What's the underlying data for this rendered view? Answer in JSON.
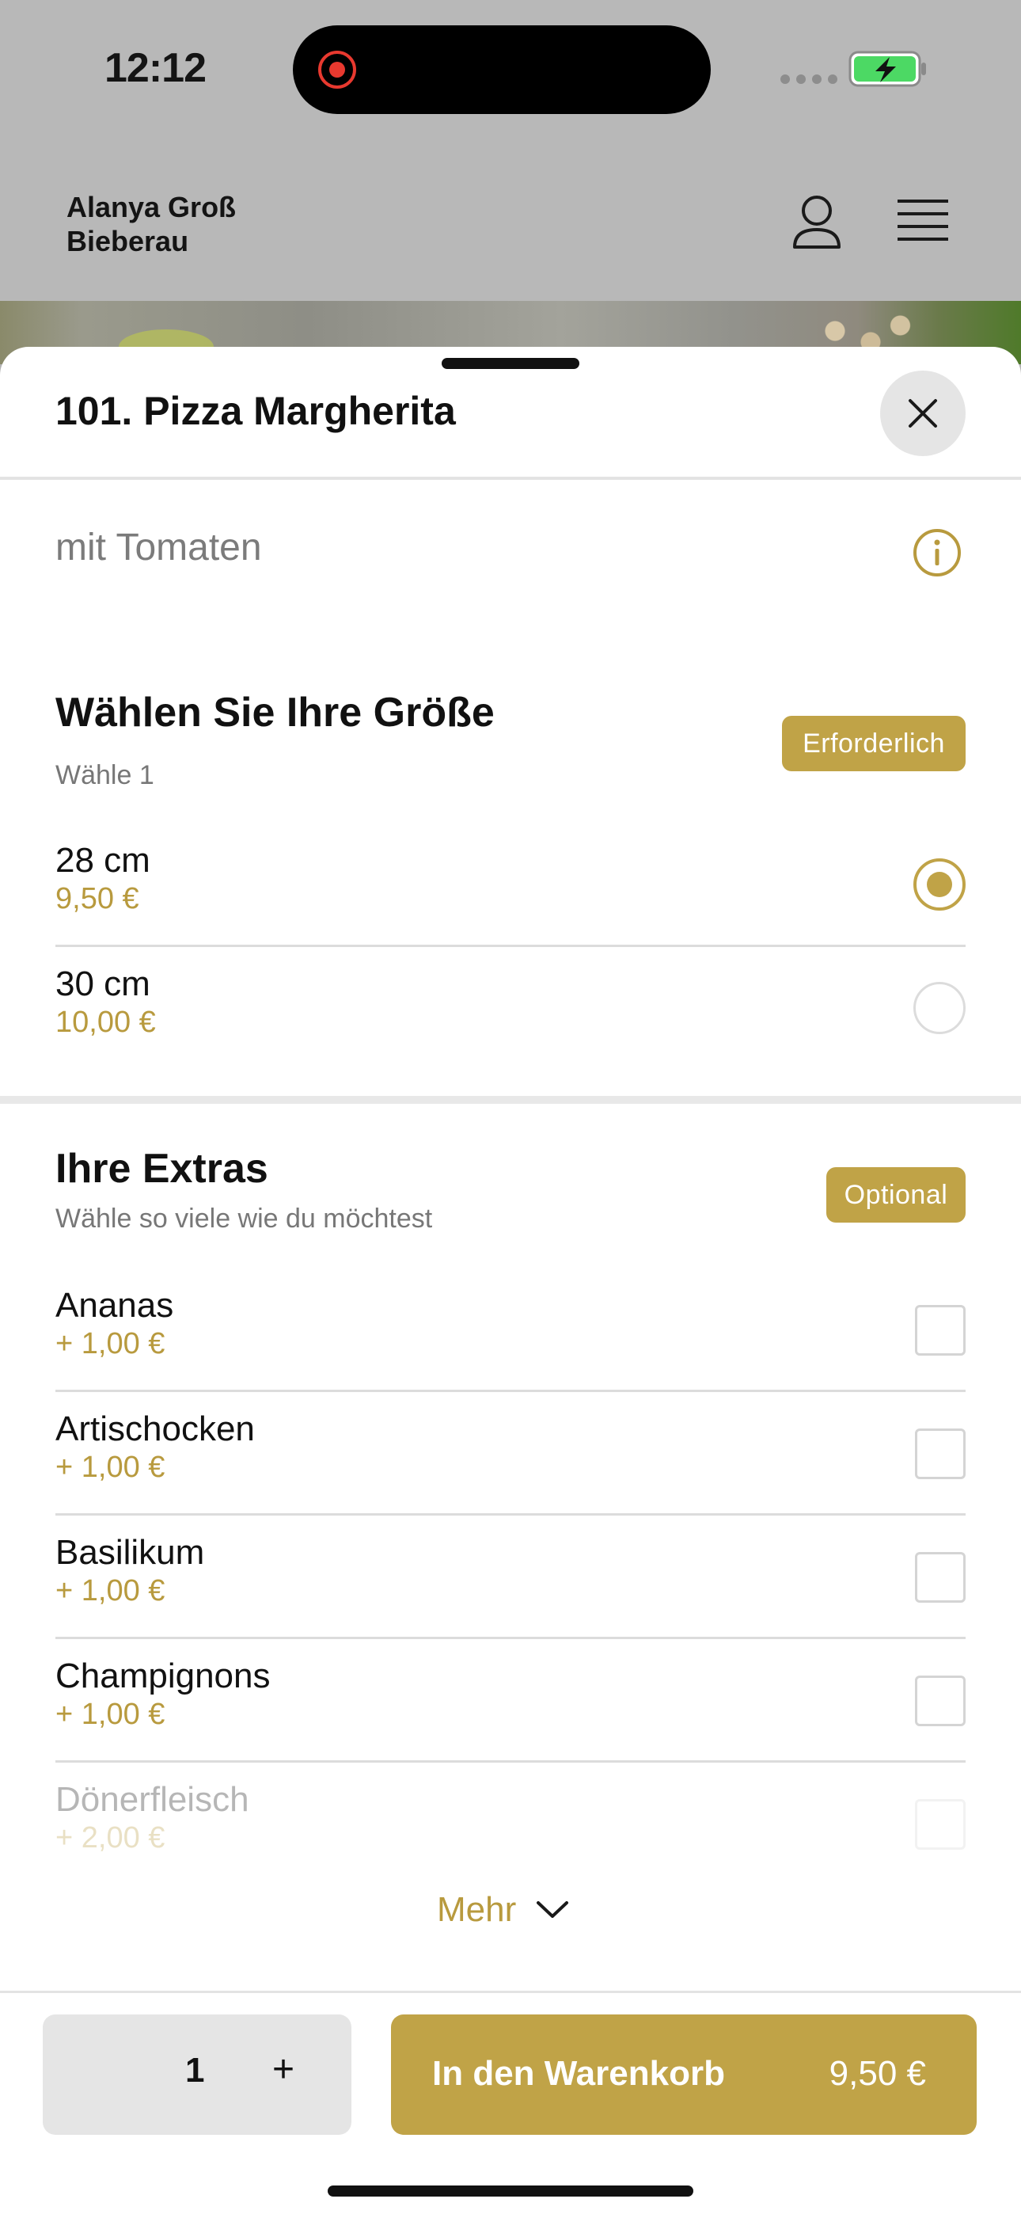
{
  "status_bar": {
    "time": "12:12"
  },
  "header": {
    "restaurant_name": "Alanya Groß Bieberau"
  },
  "sheet": {
    "title": "101. Pizza Margherita",
    "description": "mit Tomaten"
  },
  "size_section": {
    "title": "Wählen Sie Ihre Größe",
    "subtitle": "Wähle 1",
    "badge": "Erforderlich",
    "options": [
      {
        "name": "28 cm",
        "price": "9,50 €",
        "selected": true
      },
      {
        "name": "30 cm",
        "price": "10,00 €",
        "selected": false
      }
    ]
  },
  "extras_section": {
    "title": "Ihre Extras",
    "subtitle": "Wähle so viele wie du möchtest",
    "badge": "Optional",
    "items": [
      {
        "name": "Ananas",
        "price": "+ 1,00 €"
      },
      {
        "name": "Artischocken",
        "price": "+ 1,00 €"
      },
      {
        "name": "Basilikum",
        "price": "+ 1,00 €"
      },
      {
        "name": "Champignons",
        "price": "+ 1,00 €"
      },
      {
        "name": "Dönerfleisch",
        "price": "+ 2,00 €"
      }
    ],
    "more_label": "Mehr"
  },
  "footer": {
    "quantity": "1",
    "plus_label": "+",
    "cart_label": "In den Warenkorb",
    "cart_price": "9,50 €"
  },
  "colors": {
    "accent": "#c0a347",
    "price_text": "#b89a3e",
    "recording_dot": "#e8392f",
    "battery_fill": "#4cd964"
  },
  "icons": [
    "recording-icon",
    "battery-icon",
    "user-icon",
    "menu-icon",
    "close-icon",
    "info-icon",
    "chevron-down-icon"
  ]
}
